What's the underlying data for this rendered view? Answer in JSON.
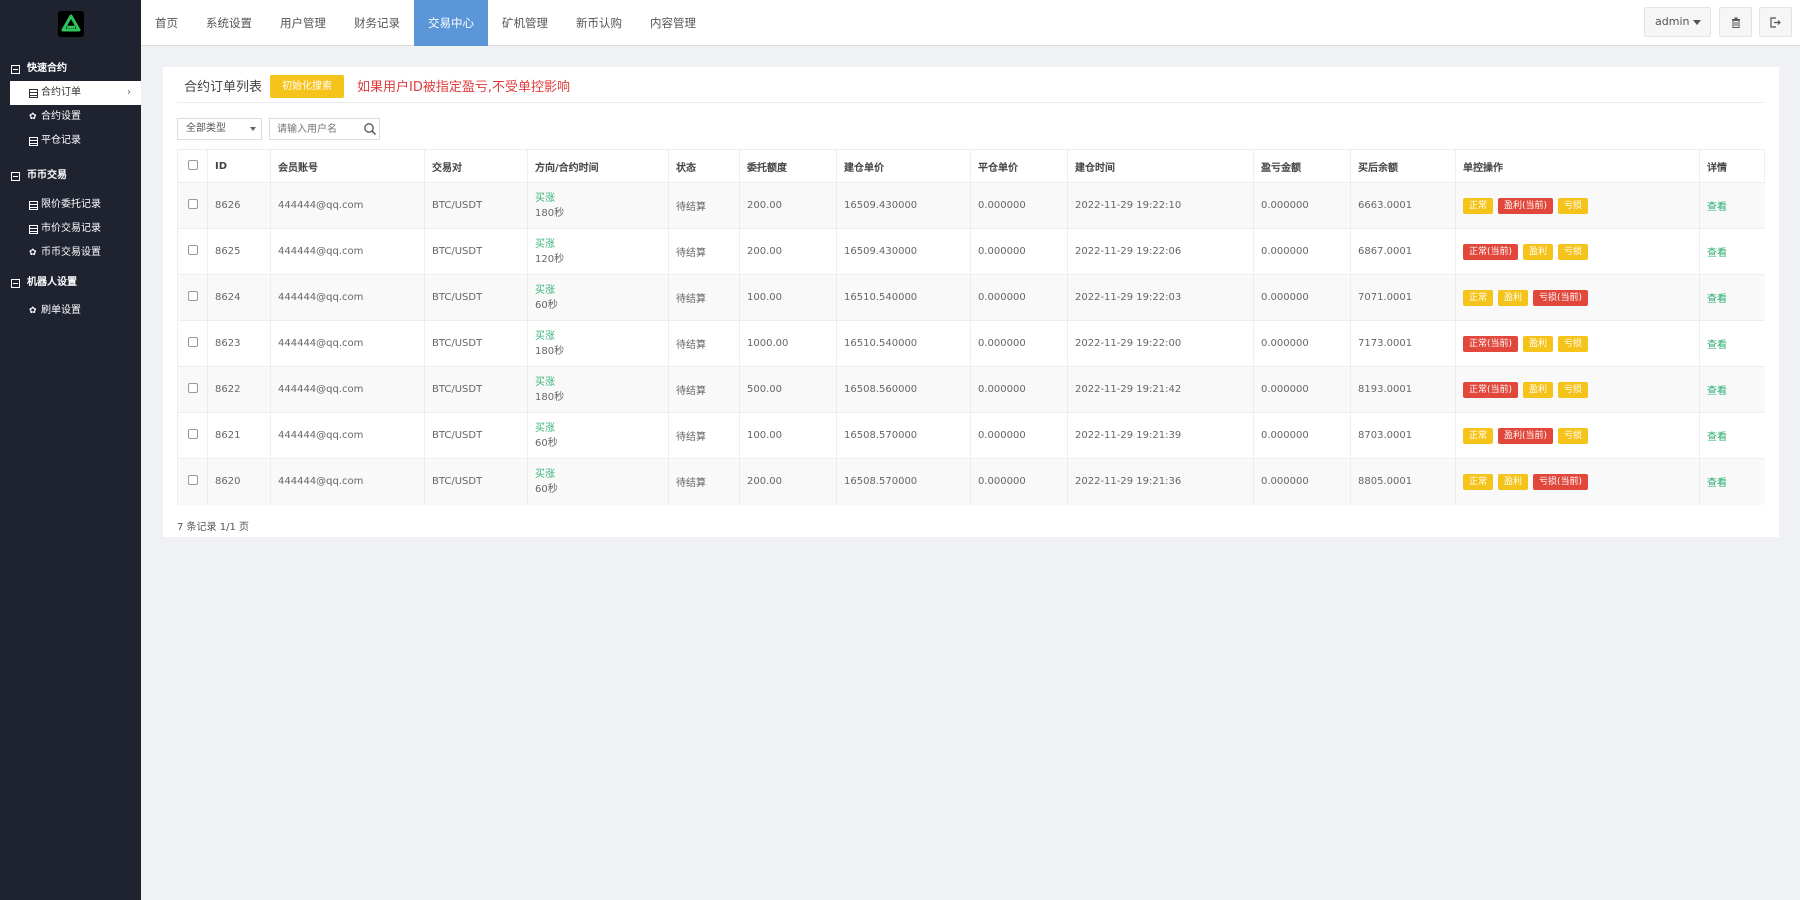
{
  "sidebar": {
    "groups": [
      {
        "title": "快速合约",
        "items": [
          "合约订单",
          "合约设置",
          "平仓记录"
        ]
      },
      {
        "title": "币币交易",
        "items": [
          "限价委托记录",
          "市价交易记录",
          "币币交易设置"
        ]
      },
      {
        "title": "机器人设置",
        "items": [
          "刷单设置"
        ]
      }
    ]
  },
  "nav": {
    "items": [
      "首页",
      "系统设置",
      "用户管理",
      "财务记录",
      "交易中心",
      "矿机管理",
      "新币认购",
      "内容管理"
    ],
    "active": "交易中心"
  },
  "header": {
    "user": "admin"
  },
  "panel": {
    "title": "合约订单列表",
    "reset_label": "初始化搜索",
    "warning": "如果用户ID被指定盈亏,不受单控影响",
    "filter_type": "全部类型",
    "search_placeholder": "请输入用户名"
  },
  "table": {
    "headers": [
      "ID",
      "会员账号",
      "交易对",
      "方向/合约时间",
      "状态",
      "委托额度",
      "建仓单价",
      "平仓单价",
      "建仓时间",
      "盈亏金额",
      "买后余额",
      "单控操作",
      "详情"
    ],
    "rows": [
      {
        "id": "8626",
        "account": "444444@qq.com",
        "pair": "BTC/USDT",
        "direction": "买涨",
        "duration": "180秒",
        "status": "待结算",
        "amount": "200.00",
        "open_price": "16509.430000",
        "close_price": "0.000000",
        "open_time": "2022-11-29 19:22:10",
        "pnl": "0.000000",
        "balance": "6663.0001",
        "actions": [
          [
            "正常",
            "y"
          ],
          [
            "盈利(当前)",
            "r"
          ],
          [
            "亏损",
            "y"
          ]
        ],
        "detail": "查看"
      },
      {
        "id": "8625",
        "account": "444444@qq.com",
        "pair": "BTC/USDT",
        "direction": "买涨",
        "duration": "120秒",
        "status": "待结算",
        "amount": "200.00",
        "open_price": "16509.430000",
        "close_price": "0.000000",
        "open_time": "2022-11-29 19:22:06",
        "pnl": "0.000000",
        "balance": "6867.0001",
        "actions": [
          [
            "正常(当前)",
            "r"
          ],
          [
            "盈利",
            "y"
          ],
          [
            "亏损",
            "y"
          ]
        ],
        "detail": "查看"
      },
      {
        "id": "8624",
        "account": "444444@qq.com",
        "pair": "BTC/USDT",
        "direction": "买涨",
        "duration": "60秒",
        "status": "待结算",
        "amount": "100.00",
        "open_price": "16510.540000",
        "close_price": "0.000000",
        "open_time": "2022-11-29 19:22:03",
        "pnl": "0.000000",
        "balance": "7071.0001",
        "actions": [
          [
            "正常",
            "y"
          ],
          [
            "盈利",
            "y"
          ],
          [
            "亏损(当前)",
            "r"
          ]
        ],
        "detail": "查看"
      },
      {
        "id": "8623",
        "account": "444444@qq.com",
        "pair": "BTC/USDT",
        "direction": "买涨",
        "duration": "180秒",
        "status": "待结算",
        "amount": "1000.00",
        "open_price": "16510.540000",
        "close_price": "0.000000",
        "open_time": "2022-11-29 19:22:00",
        "pnl": "0.000000",
        "balance": "7173.0001",
        "actions": [
          [
            "正常(当前)",
            "r"
          ],
          [
            "盈利",
            "y"
          ],
          [
            "亏损",
            "y"
          ]
        ],
        "detail": "查看"
      },
      {
        "id": "8622",
        "account": "444444@qq.com",
        "pair": "BTC/USDT",
        "direction": "买涨",
        "duration": "180秒",
        "status": "待结算",
        "amount": "500.00",
        "open_price": "16508.560000",
        "close_price": "0.000000",
        "open_time": "2022-11-29 19:21:42",
        "pnl": "0.000000",
        "balance": "8193.0001",
        "actions": [
          [
            "正常(当前)",
            "r"
          ],
          [
            "盈利",
            "y"
          ],
          [
            "亏损",
            "y"
          ]
        ],
        "detail": "查看"
      },
      {
        "id": "8621",
        "account": "444444@qq.com",
        "pair": "BTC/USDT",
        "direction": "买涨",
        "duration": "60秒",
        "status": "待结算",
        "amount": "100.00",
        "open_price": "16508.570000",
        "close_price": "0.000000",
        "open_time": "2022-11-29 19:21:39",
        "pnl": "0.000000",
        "balance": "8703.0001",
        "actions": [
          [
            "正常",
            "y"
          ],
          [
            "盈利(当前)",
            "r"
          ],
          [
            "亏损",
            "y"
          ]
        ],
        "detail": "查看"
      },
      {
        "id": "8620",
        "account": "444444@qq.com",
        "pair": "BTC/USDT",
        "direction": "买涨",
        "duration": "60秒",
        "status": "待结算",
        "amount": "200.00",
        "open_price": "16508.570000",
        "close_price": "0.000000",
        "open_time": "2022-11-29 19:21:36",
        "pnl": "0.000000",
        "balance": "8805.0001",
        "actions": [
          [
            "正常",
            "y"
          ],
          [
            "盈利",
            "y"
          ],
          [
            "亏损(当前)",
            "r"
          ]
        ],
        "detail": "查看"
      }
    ]
  },
  "pagination": {
    "text": "7 条记录 1/1 页"
  },
  "colors": {
    "sidebar_bg": "#1f2330",
    "nav_active": "#5b97d8",
    "yellow": "#f6c31a",
    "red": "#e1483b",
    "green": "#2aab6f",
    "warning_text": "#e03c3c"
  }
}
